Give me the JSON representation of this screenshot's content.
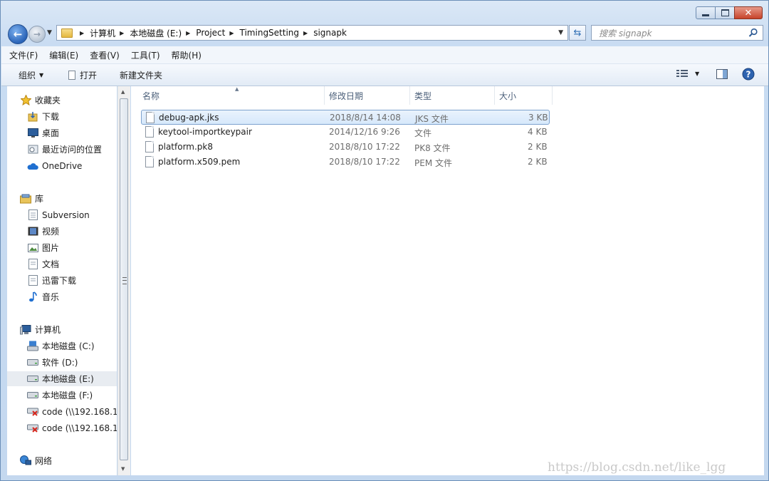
{
  "window": {
    "colors": {
      "accent": "#2a64b8",
      "close": "#c7432a",
      "selection": "#d6e8fb"
    }
  },
  "address": {
    "crumbs": [
      "计算机",
      "本地磁盘 (E:)",
      "Project",
      "TimingSetting",
      "signapk"
    ]
  },
  "search": {
    "placeholder": "搜索 signapk"
  },
  "menu": [
    "文件(F)",
    "编辑(E)",
    "查看(V)",
    "工具(T)",
    "帮助(H)"
  ],
  "toolbar": {
    "organize": "组织",
    "open": "打开",
    "new_folder": "新建文件夹"
  },
  "nav": {
    "favorites": {
      "label": "收藏夹",
      "items": [
        "下载",
        "桌面",
        "最近访问的位置",
        "OneDrive"
      ]
    },
    "libraries": {
      "label": "库",
      "items": [
        "Subversion",
        "视频",
        "图片",
        "文档",
        "迅雷下载",
        "音乐"
      ]
    },
    "computer": {
      "label": "计算机",
      "items": [
        "本地磁盘 (C:)",
        "软件 (D:)",
        "本地磁盘 (E:)",
        "本地磁盘 (F:)",
        "code (\\\\192.168.1",
        "code (\\\\192.168.1"
      ]
    },
    "network": {
      "label": "网络"
    },
    "selected": "本地磁盘 (E:)"
  },
  "columns": {
    "name": "名称",
    "modified": "修改日期",
    "type": "类型",
    "size": "大小"
  },
  "files": [
    {
      "name": "debug-apk.jks",
      "modified": "2018/8/14 14:08",
      "type": "JKS 文件",
      "size": "3 KB",
      "selected": true
    },
    {
      "name": "keytool-importkeypair",
      "modified": "2014/12/16 9:26",
      "type": "文件",
      "size": "4 KB"
    },
    {
      "name": "platform.pk8",
      "modified": "2018/8/10 17:22",
      "type": "PK8 文件",
      "size": "2 KB"
    },
    {
      "name": "platform.x509.pem",
      "modified": "2018/8/10 17:22",
      "type": "PEM 文件",
      "size": "2 KB"
    }
  ],
  "watermark": "https://blog.csdn.net/like_lgg"
}
